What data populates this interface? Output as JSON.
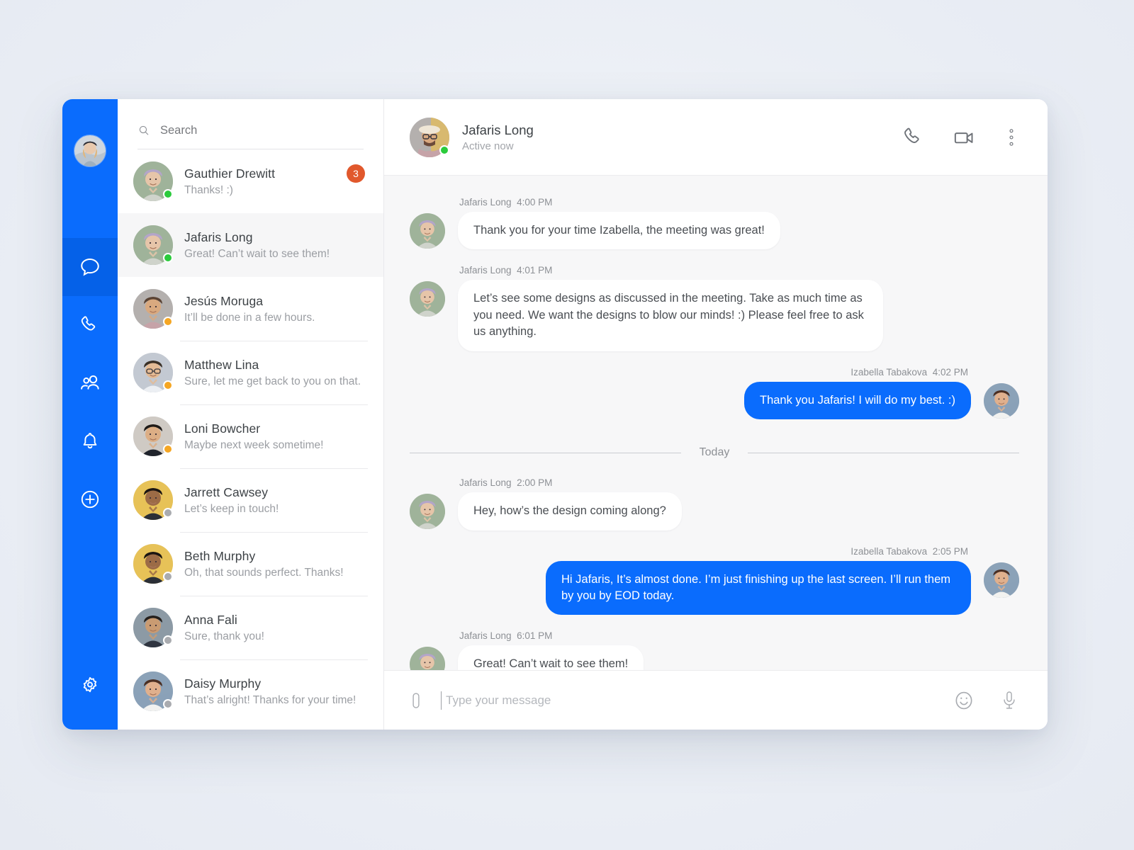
{
  "theme": {
    "brand_blue": "#0a6cfd",
    "brand_blue_active": "#0561e8",
    "badge_orange": "#e1582c",
    "status_online": "#2bcb3c",
    "status_away": "#f5a623",
    "status_offline": "#a9abaf",
    "page_background": "#eef1f6",
    "chat_background": "#f7f7f8"
  },
  "nav": {
    "profile_avatar_name": "Izabella Tabakova",
    "items": [
      {
        "icon": "chat-bubble-icon",
        "label": "Chats",
        "active": true
      },
      {
        "icon": "phone-icon",
        "label": "Calls",
        "active": false
      },
      {
        "icon": "contacts-icon",
        "label": "Contacts",
        "active": false
      },
      {
        "icon": "bell-icon",
        "label": "Notifications",
        "active": false
      },
      {
        "icon": "plus-circle-icon",
        "label": "New",
        "active": false
      }
    ],
    "settings": {
      "icon": "gear-icon",
      "label": "Settings"
    }
  },
  "search": {
    "icon": "search-icon",
    "placeholder": "Search",
    "value": ""
  },
  "conversations": [
    {
      "name": "Gauthier Drewitt",
      "preview": "Thanks! :)",
      "status": "online",
      "badge": "3",
      "selected": false
    },
    {
      "name": "Jafaris Long",
      "preview": "Great! Can’t wait to see them!",
      "status": "online",
      "badge": "",
      "selected": true
    },
    {
      "name": "Jesús Moruga",
      "preview": "It’ll be done in a few hours.",
      "status": "away",
      "badge": "",
      "selected": false
    },
    {
      "name": "Matthew Lina",
      "preview": "Sure, let me get back to you on that.",
      "status": "away",
      "badge": "",
      "selected": false
    },
    {
      "name": "Loni Bowcher",
      "preview": "Maybe next week sometime!",
      "status": "away",
      "badge": "",
      "selected": false
    },
    {
      "name": "Jarrett Cawsey",
      "preview": "Let’s keep in touch!",
      "status": "offline",
      "badge": "",
      "selected": false
    },
    {
      "name": "Beth Murphy",
      "preview": "Oh, that sounds perfect. Thanks!",
      "status": "offline",
      "badge": "",
      "selected": false
    },
    {
      "name": "Anna Fali",
      "preview": "Sure, thank you!",
      "status": "offline",
      "badge": "",
      "selected": false
    },
    {
      "name": "Daisy Murphy",
      "preview": "That’s alright! Thanks for your time!",
      "status": "offline",
      "badge": "",
      "selected": false
    }
  ],
  "chat_header": {
    "name": "Jafaris Long",
    "status": "Active now",
    "status_dot": "online",
    "actions": [
      {
        "icon": "phone-call-icon",
        "label": "Voice call"
      },
      {
        "icon": "video-camera-icon",
        "label": "Video call"
      },
      {
        "icon": "more-vertical-icon",
        "label": "More options"
      }
    ]
  },
  "messages": [
    {
      "direction": "in",
      "sender": "Jafaris Long",
      "time": "4:00 PM",
      "text": "Thank you for your time Izabella, the meeting was great!"
    },
    {
      "direction": "in",
      "sender": "Jafaris Long",
      "time": "4:01 PM",
      "text": "Let’s see some designs as discussed in the meeting. Take as much time as you need. We want the designs to blow our minds! :) Please feel free to ask us anything."
    },
    {
      "direction": "out",
      "sender": "Izabella Tabakova",
      "time": "4:02 PM",
      "text": "Thank you Jafaris! I will do my best. :)"
    },
    {
      "direction": "in",
      "sender": "Jafaris Long",
      "time": "2:00 PM",
      "text": "Hey, how’s the design coming along?"
    },
    {
      "direction": "out",
      "sender": "Izabella Tabakova",
      "time": "2:05 PM",
      "text": "Hi Jafaris, It’s almost done. I’m just finishing up the last screen. I’ll run them by you by EOD today."
    },
    {
      "direction": "in",
      "sender": "Jafaris Long",
      "time": "6:01 PM",
      "text": "Great! Can’t wait to see them!"
    }
  ],
  "day_divider": {
    "label": "Today"
  },
  "composer": {
    "attach_icon": "paperclip-icon",
    "placeholder": "Type your message",
    "value": "",
    "emoji_icon": "smiley-icon",
    "mic_icon": "microphone-icon"
  }
}
